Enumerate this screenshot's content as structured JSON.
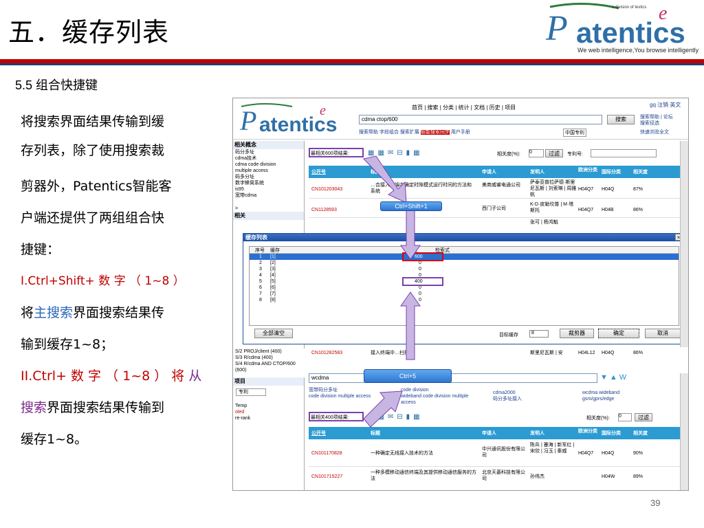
{
  "slide": {
    "title": "五．缓存列表",
    "section": "5.5  组合快捷键",
    "page_number": "39",
    "body_lines": [
      {
        "text": "将搜索界面结果传输到缓"
      },
      {
        "text": "存列表，除了使用搜索裁"
      },
      {
        "text": "剪器外，Patentics智能客"
      },
      {
        "text": "户端还提供了两组组合快"
      },
      {
        "text": "捷键："
      },
      {
        "text": "I.Ctrl+Shift+ 数 字 （ 1~8 ）"
      },
      {
        "text_a": "将",
        "text_b": "主搜索",
        "text_c": "界面搜索结果传"
      },
      {
        "text": "输到缓存1~8；"
      },
      {
        "text_a": "II.Ctrl+ 数 字 （ 1~8 ） 将 ",
        "text_b": "从"
      },
      {
        "text_a": "搜索",
        "text_b": "界面搜索结果传输到"
      },
      {
        "text": "缓存1~8。"
      }
    ]
  },
  "logo": {
    "brand": "atentics",
    "lead": "P",
    "tagline": "a division of textics",
    "slogan": "We web intelligence,You browse intelligently"
  },
  "app": {
    "nav": "首页 | 搜索 | 分类 | 统计 | 文档 | 历史 | 项目",
    "user": "gq 注销 英文",
    "search_value": "cdma ctop/600",
    "search_button": "搜索",
    "links_right": [
      "搜索帮助 | 论坛",
      "搜索径选",
      "快速浏览全文"
    ],
    "sub_links": [
      "搜索帮助",
      "字段组合",
      "搜索扩展",
      "智能搜索同步",
      "用户手册"
    ],
    "db_select": "中国专利",
    "related_label": "相关度(%):",
    "related_value": "0",
    "filter_button": "过滤",
    "patent_no_label": "专利号:",
    "results_label": "最相关600项结果:",
    "columns": [
      "公开号",
      "标题",
      "申请人",
      "发明人",
      "欧洲分类",
      "国际分类",
      "相关度"
    ],
    "rows": [
      {
        "no": "CN101203043",
        "title": "…合接入终端中确定时隙模式运行时间的方法和系统",
        "applicant": "美商威睿电通公司",
        "inventor": "萨泰亚普拉萨德·斯里尼瓦斯 | 刘索琳 | 周雅帆",
        "ipc": "H04Q7",
        "ipc2": "H04Q",
        "rel": "87%"
      },
      {
        "no": "CN1128593",
        "title": "",
        "applicant": "西门子公司",
        "inventor": "K-D·皮勒坎普 | M·塔斯托",
        "ipc": "H04Q7",
        "ipc2": "H04B",
        "rel": "86%"
      },
      {
        "no": "",
        "title": "",
        "applicant": "",
        "inventor": "张可 | 杨鸿魁",
        "ipc": "",
        "ipc2": "",
        "rel": ""
      },
      {
        "no": "CN101282583",
        "title": "接入终端中…扫描",
        "applicant": "",
        "inventor": "斯里尼瓦斯 | 安",
        "ipc": "H04L12",
        "ipc2": "H04Q",
        "rel": "86%"
      }
    ],
    "left_top": {
      "header": "相关概念",
      "items": [
        "码分多址",
        "cdma技术",
        "cdma code division multiple access",
        "码多分址",
        "数字蜂窝系统",
        "is95",
        "宽带cdma"
      ]
    },
    "left_mid_items": [
      ">",
      "相关"
    ],
    "left_queries": [
      "S/2 PROJ/client (400)",
      "S/3 R/cdma (400)",
      "S/4 R/cdma AND CTOP/600 (600)"
    ],
    "left_bottom": {
      "header": "项目",
      "select": "专利",
      "items": [
        "Temp",
        "oled",
        "re-rank"
      ]
    },
    "dialog": {
      "title": "缓存列表",
      "close": "×",
      "columns": [
        "序号",
        "缓存",
        "条数",
        "检索式"
      ],
      "rows": [
        {
          "idx": "1",
          "name": "[1]",
          "count": "600"
        },
        {
          "idx": "2",
          "name": "[2]",
          "count": "0"
        },
        {
          "idx": "3",
          "name": "[3]",
          "count": "0"
        },
        {
          "idx": "4",
          "name": "[4]",
          "count": "0"
        },
        {
          "idx": "5",
          "name": "[5]",
          "count": "400"
        },
        {
          "idx": "6",
          "name": "[6]",
          "count": "0"
        },
        {
          "idx": "7",
          "name": "[7]",
          "count": "0"
        },
        {
          "idx": "8",
          "name": "[8]",
          "count": "0"
        }
      ],
      "clear_button": "全部清空",
      "target_label": "目标缓存",
      "target_value": "8",
      "clip_button": "裁剪器",
      "ok_button": "确定",
      "cancel_button": "取消"
    },
    "sub_search": {
      "value": "wcdma",
      "links": [
        "宽带码分多址",
        "code division multiple access",
        "code division",
        "wideband code division multiple access",
        "cdma2000",
        "码分多址接入",
        "wcdma wideband",
        "gsm/gprs/edge"
      ],
      "results_label": "最相关400项结果:",
      "related_label": "相关度(%):",
      "related_value": "0",
      "filter_button": "过滤",
      "rows": [
        {
          "no": "CN101170828",
          "title": "一种确定无线接入技术的方法",
          "applicant": "中兴通讯股份有限公司",
          "inventor": "陈兵 | 蹇海 | 新军红 | 宋欣 | 冯玉 | 秦威",
          "ipc": "H04Q7",
          "ipc2": "H04Q",
          "rel": "90%"
        },
        {
          "no": "CN101715227",
          "title": "一种多模移动通信终端及其提供移动通信服务的方法",
          "applicant": "北京天碁科技有限公司",
          "inventor": "孙伟杰",
          "ipc": "",
          "ipc2": "H04W",
          "rel": "89%"
        }
      ]
    },
    "callouts": [
      "Ctrl+Shift+1",
      "Ctrl+5"
    ]
  },
  "colors": {
    "accent_red": "#c00000",
    "grid_header": "#2b9bd2",
    "link_blue": "#1a3f8b",
    "dialog_title": "#1c4fa1"
  }
}
